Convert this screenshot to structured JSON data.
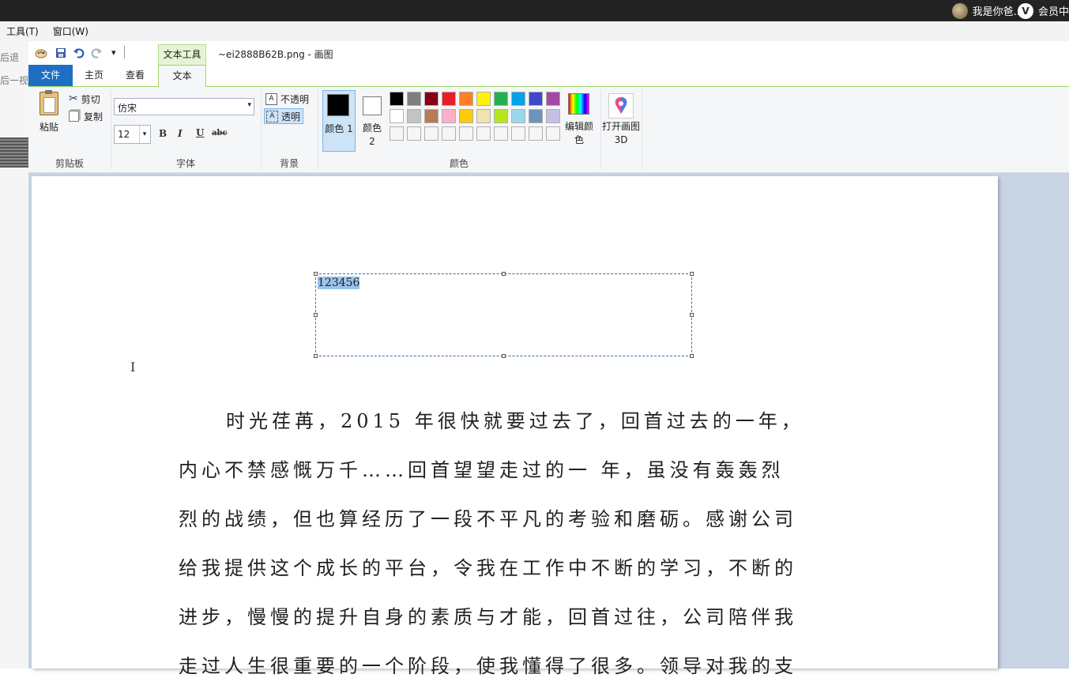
{
  "topbar": {
    "user_name": "我是你爸...",
    "vip_label": "会员中"
  },
  "outer_menu": [
    "工具(T)",
    "窗口(W)"
  ],
  "left_strip": {
    "text1": "后退",
    "text2": "后一视图"
  },
  "window": {
    "title": "~ei2888B62B.png - 画图",
    "context_tab": "文本工具"
  },
  "tabs": [
    "文件",
    "主页",
    "查看",
    "文本"
  ],
  "clipboard": {
    "paste": "粘贴",
    "cut": "剪切",
    "copy": "复制",
    "label": "剪贴板"
  },
  "font": {
    "family": "仿宋",
    "size": "12",
    "bold": "B",
    "italic": "I",
    "underline": "U",
    "strike": "abc",
    "label": "字体"
  },
  "background": {
    "opaque": "不透明",
    "transparent": "透明",
    "label": "背景"
  },
  "colors": {
    "color1_label": "颜色 1",
    "color2_label": "颜色 2",
    "edit_label": "编辑颜色",
    "open3d_label": "打开画图 3D",
    "label": "颜色",
    "color1": "#000000",
    "color2": "#ffffff",
    "row1": [
      "#000000",
      "#7f7f7f",
      "#880015",
      "#ed1c24",
      "#ff7f27",
      "#fff200",
      "#22b14c",
      "#00a2e8",
      "#3f48cc",
      "#a349a4"
    ],
    "row2": [
      "#ffffff",
      "#c3c3c3",
      "#b97a57",
      "#ffaec9",
      "#ffc90e",
      "#efe4b0",
      "#b5e61d",
      "#99d9ea",
      "#7092be",
      "#c8bfe7"
    ]
  },
  "canvas": {
    "textbox_value": "123456",
    "paragraph": [
      "时光荏苒，2015 年很快就要过去了，回首过去的一年，",
      "内心不禁感慨万千……回首望望走过的一 年，虽没有轰轰烈",
      "烈的战绩，但也算经历了一段不平凡的考验和磨砺。感谢公司",
      "给我提供这个成长的平台，令我在工作中不断的学习，不断的",
      "进步，慢慢的提升自身的素质与才能，回首过往，公司陪伴我",
      "走过人生很重要的一个阶段，使我懂得了很多。领导对我的支"
    ]
  }
}
